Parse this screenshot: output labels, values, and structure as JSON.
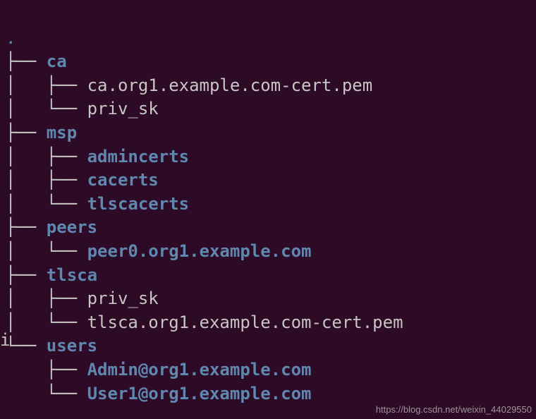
{
  "root_dot": ".",
  "left_char": "i",
  "tree": {
    "ca": {
      "label": "ca",
      "children": [
        {
          "label": "ca.org1.example.com-cert.pem",
          "type": "file"
        },
        {
          "label": "priv_sk",
          "type": "file"
        }
      ]
    },
    "msp": {
      "label": "msp",
      "children": [
        {
          "label": "admincerts",
          "type": "dir"
        },
        {
          "label": "cacerts",
          "type": "dir"
        },
        {
          "label": "tlscacerts",
          "type": "dir"
        }
      ]
    },
    "peers": {
      "label": "peers",
      "children": [
        {
          "label": "peer0.org1.example.com",
          "type": "dir"
        }
      ]
    },
    "tlsca": {
      "label": "tlsca",
      "children": [
        {
          "label": "priv_sk",
          "type": "file"
        },
        {
          "label": "tlsca.org1.example.com-cert.pem",
          "type": "file"
        }
      ]
    },
    "users": {
      "label": "users",
      "children": [
        {
          "label": "Admin@org1.example.com",
          "type": "dir"
        },
        {
          "label": "User1@org1.example.com",
          "type": "dir"
        }
      ]
    }
  },
  "watermark": "https://blog.csdn.net/weixin_44029550"
}
